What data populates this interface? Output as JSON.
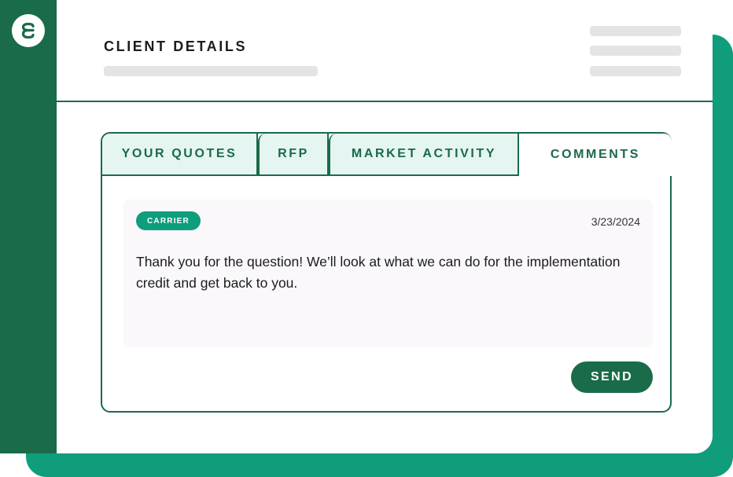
{
  "colors": {
    "brand_dark": "#1a6b49",
    "brand_accent": "#0f9d7c",
    "tab_inactive_bg": "#e5f5f2",
    "comment_bg": "#faf8fb"
  },
  "sidebar": {
    "logo_icon": "brand-logo-icon"
  },
  "header": {
    "title": "CLIENT DETAILS"
  },
  "tabs": [
    {
      "label": "YOUR QUOTES",
      "active": false
    },
    {
      "label": "RFP",
      "active": false
    },
    {
      "label": "MARKET ACTIVITY",
      "active": false
    },
    {
      "label": "COMMENTS",
      "active": true
    }
  ],
  "comment": {
    "badge": "CARRIER",
    "date": "3/23/2024",
    "text": "Thank you for the question! We’ll look at what we can do for the implementation credit and get back to you."
  },
  "actions": {
    "send_label": "SEND"
  }
}
